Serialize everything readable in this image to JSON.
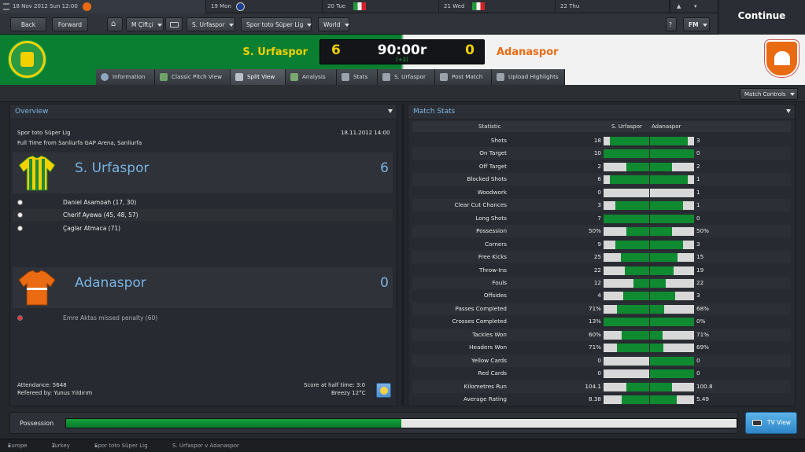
{
  "calendar": {
    "current": "18 Nov 2012 Sun 12:00",
    "days": [
      {
        "label": "19 Mon",
        "icon": "club-badge-icon"
      },
      {
        "label": "20 Tue",
        "icon": "italy-flag-icon"
      },
      {
        "label": "21 Wed",
        "icon": "italy-flag-icon"
      },
      {
        "label": "22 Thu",
        "icon": ""
      }
    ]
  },
  "nav": {
    "back": "Back",
    "forward": "Forward",
    "manager": "M Çiftçi",
    "club": "S. Urfaspor",
    "competition": "Spor toto Süper Lig",
    "world": "World",
    "help": "?",
    "fm": "FM",
    "continue": "Continue"
  },
  "match": {
    "home_team": "S. Urfaspor",
    "away_team": "Adanaspor",
    "home_score": "6",
    "away_score": "0",
    "clock": "90:00r",
    "added_time": "(+2)",
    "home_color": "#f3d100",
    "away_color": "#ea6b12"
  },
  "tabs": [
    "Information",
    "Classic Pitch View",
    "Split View",
    "Analysis",
    "Stats",
    "S. Urfaspor",
    "Post Match",
    "Upload Highlights"
  ],
  "active_tab": "Split View",
  "match_controls": "Match Controls",
  "overview": {
    "title": "Overview",
    "competition": "Spor toto Süper Lig",
    "datetime": "18.11.2012 14:00",
    "venue": "Full Time from Sanliurfa GAP Arena, Sanliurfa",
    "home": {
      "name": "S. Urfaspor",
      "score": "6",
      "events": [
        "Daniel Asamoah (17, 30)",
        "Cherif Ayewa (45, 48, 57)",
        "Çaglar Atmaca (71)"
      ]
    },
    "away": {
      "name": "Adanaspor",
      "score": "0",
      "events": [
        "Emre Aktas missed penalty (60)"
      ]
    },
    "attendance": "Attendance: 5648",
    "referee": "Refereed by: Yunus Yıldırım",
    "halftime": "Score at half time: 3:0",
    "weather": "Breezy 12°C"
  },
  "stats": {
    "title": "Match Stats",
    "col_statistic": "Statistic",
    "col_home": "S. Urfaspor",
    "col_away": "Adanaspor",
    "rows": [
      {
        "name": "Shots",
        "home": "18",
        "away": "3",
        "hf": 0.86,
        "af": 0.14
      },
      {
        "name": "On Target",
        "home": "10",
        "away": "0",
        "hf": 1.0,
        "af": 0.0
      },
      {
        "name": "Off Target",
        "home": "2",
        "away": "2",
        "hf": 0.5,
        "af": 0.5
      },
      {
        "name": "Blocked Shots",
        "home": "6",
        "away": "1",
        "hf": 0.86,
        "af": 0.14
      },
      {
        "name": "Woodwork",
        "home": "0",
        "away": "1",
        "hf": 0.0,
        "af": 1.0
      },
      {
        "name": "Clear Cut Chances",
        "home": "3",
        "away": "1",
        "hf": 0.75,
        "af": 0.25
      },
      {
        "name": "Long Shots",
        "home": "7",
        "away": "0",
        "hf": 1.0,
        "af": 0.0
      },
      {
        "name": "Possession",
        "home": "50%",
        "away": "50%",
        "hf": 0.5,
        "af": 0.5
      },
      {
        "name": "Corners",
        "home": "9",
        "away": "3",
        "hf": 0.75,
        "af": 0.25
      },
      {
        "name": "Free Kicks",
        "home": "25",
        "away": "15",
        "hf": 0.625,
        "af": 0.375
      },
      {
        "name": "Throw-Ins",
        "home": "22",
        "away": "19",
        "hf": 0.54,
        "af": 0.46
      },
      {
        "name": "Fouls",
        "home": "12",
        "away": "22",
        "hf": 0.35,
        "af": 0.65
      },
      {
        "name": "Offsides",
        "home": "4",
        "away": "3",
        "hf": 0.57,
        "af": 0.43
      },
      {
        "name": "Passes Completed",
        "home": "71%",
        "away": "68%",
        "hf": 0.71,
        "af": 0.68
      },
      {
        "name": "Crosses Completed",
        "home": "13%",
        "away": "0%",
        "hf": 1.0,
        "af": 0.0
      },
      {
        "name": "Tackles Won",
        "home": "60%",
        "away": "71%",
        "hf": 0.6,
        "af": 0.71
      },
      {
        "name": "Headers Won",
        "home": "71%",
        "away": "69%",
        "hf": 0.71,
        "af": 0.69
      },
      {
        "name": "Yellow Cards",
        "home": "0",
        "away": "0",
        "hf": 0.0,
        "af": 0.0
      },
      {
        "name": "Red Cards",
        "home": "0",
        "away": "0",
        "hf": 0.0,
        "af": 0.0
      },
      {
        "name": "Kilometres Run",
        "home": "104.1",
        "away": "100.8",
        "hf": 0.508,
        "af": 0.492
      },
      {
        "name": "Average Rating",
        "home": "8.38",
        "away": "5.49",
        "hf": 0.6,
        "af": 0.4
      }
    ]
  },
  "possession": {
    "label": "Possession",
    "home_fraction": 0.5
  },
  "tv_view": "TV View",
  "breadcrumb": [
    "Europe",
    "Turkey",
    "Spor toto Süper Lig",
    "S. Urfaspor v Adanaspor"
  ]
}
